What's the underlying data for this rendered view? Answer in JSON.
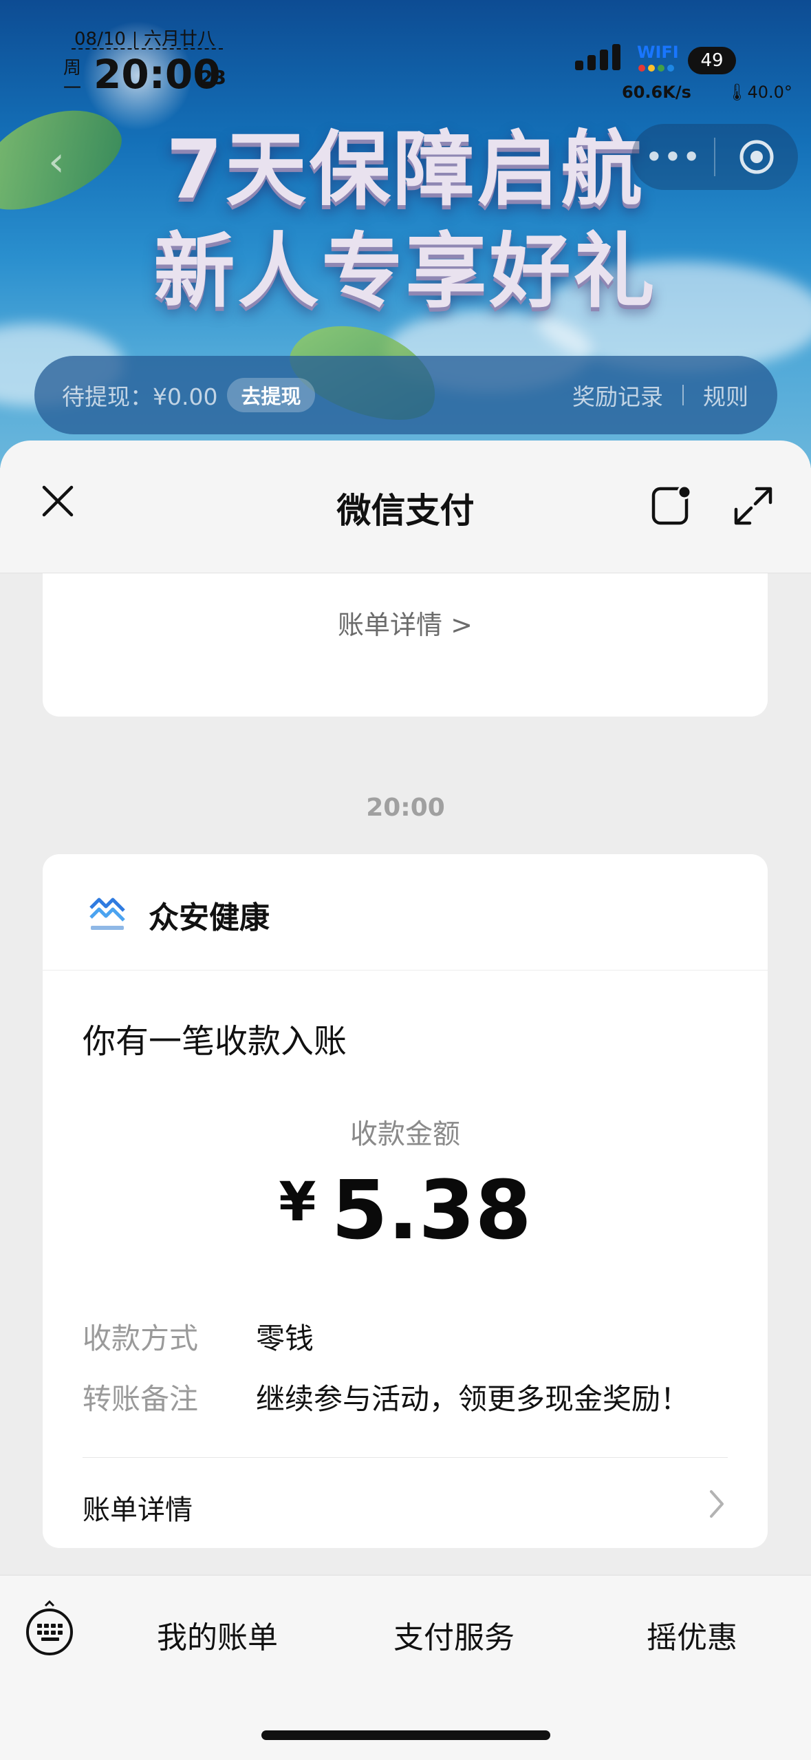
{
  "status_bar": {
    "date": "08/10",
    "lunar": "六月廿八",
    "weekday": "周一",
    "time": "20:00",
    "seconds": "23",
    "wifi": "WIFI",
    "battery": "49",
    "net_speed": "60.6K/s",
    "temperature": "40.0°"
  },
  "banner": {
    "headline_line1": "7天保障启航",
    "headline_line2": "新人专享好礼",
    "pending_withdraw": "待提现：¥0.00",
    "withdraw_button": "去提现",
    "reward_records": "奖励记录",
    "rules": "规则"
  },
  "sheet": {
    "title": "微信支付"
  },
  "previous_card": {
    "bill_link": "账单详情 >"
  },
  "message": {
    "timestamp": "20:00",
    "merchant": "众安健康",
    "heading": "你有一笔收款入账",
    "amount_label": "收款金额",
    "currency": "¥",
    "amount": "5.38",
    "method_label": "收款方式",
    "method_value": "零钱",
    "remark_label": "转账备注",
    "remark_value": "继续参与活动，领更多现金奖励！",
    "detail_link": "账单详情"
  },
  "bottom_bar": {
    "items": [
      "我的账单",
      "支付服务",
      "摇优惠"
    ]
  }
}
